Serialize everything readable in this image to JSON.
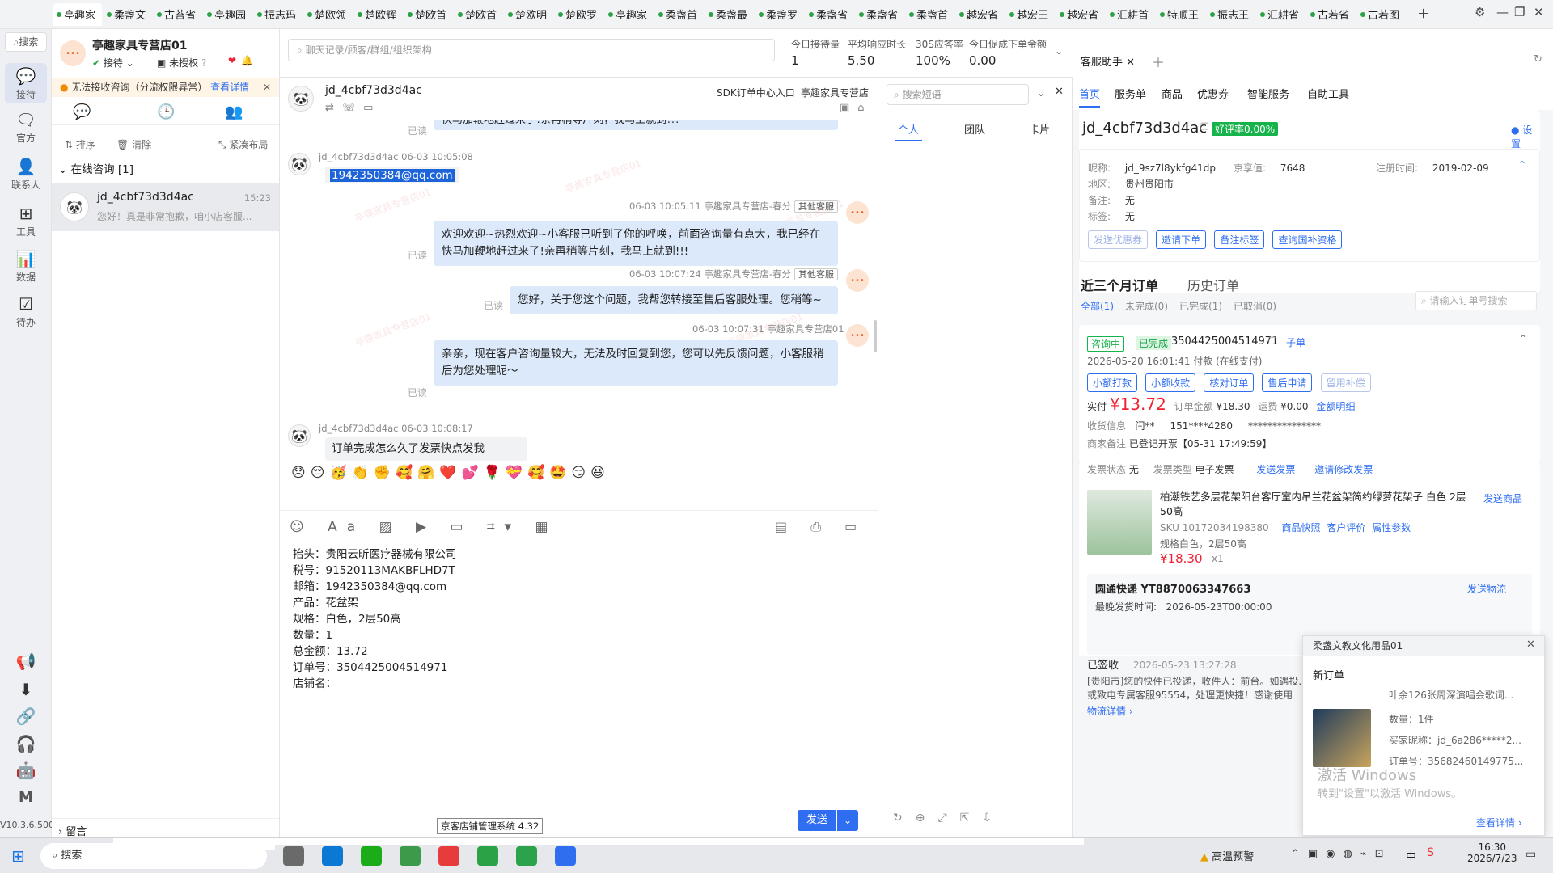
{
  "tabs": [
    "亭趣家",
    "柔盏文",
    "古苔省",
    "亭趣园",
    "振志玛",
    "楚欧领",
    "楚欧辉",
    "楚欧首",
    "楚欧首",
    "楚欧明",
    "楚欧罗",
    "亭趣家",
    "柔盏首",
    "柔盏最",
    "柔盏罗",
    "柔盏省",
    "柔盏省",
    "柔盏首",
    "越宏省",
    "越宏王",
    "越宏省",
    "汇耕首",
    "特顺王",
    "振志王",
    "汇耕省",
    "古若省",
    "古若图"
  ],
  "nav": {
    "search": "搜索",
    "items": [
      "接待",
      "官方",
      "联系人",
      "工具",
      "数据",
      "待办"
    ],
    "version": "V10.3.6.500"
  },
  "convlist": {
    "shop_name": "亭趣家具专营店01",
    "status": "接待",
    "auth": "未授权",
    "warning": "无法接收咨询（分流权限异常）",
    "warning_link": "查看详情",
    "actions": [
      "排序",
      "清除",
      "紧凑布局"
    ],
    "group": "在线咨询 [1]",
    "conv_name": "jd_4cbf73d3d4ac",
    "conv_time": "15:23",
    "conv_preview": "您好！真是非常抱歉，咱小店客服...",
    "footer": "留言"
  },
  "stats": {
    "search_placeholder": "聊天记录/顾客/群组/组织架构",
    "items": [
      {
        "label": "今日接待量",
        "value": "1"
      },
      {
        "label": "平均响应时长",
        "value": "5.50"
      },
      {
        "label": "30S应答率",
        "value": "100%"
      },
      {
        "label": "今日促成下单金额",
        "value": "0.00"
      }
    ]
  },
  "chat": {
    "title": "jd_4cbf73d3d4ac",
    "sdk": "SDK订单中心入口",
    "shop": "亭趣家具专营店",
    "top_bubble_tail": "快马加鞭地赶过来了!亲再稍等片刻，我马上就到!!!",
    "read": "已读",
    "messages": [
      {
        "meta": "jd_4cbf73d3d4ac  06-03 10:05:08",
        "text": "1942350384@qq.com"
      },
      {
        "meta": "06-03 10:05:11  亭趣家具专营店-春分",
        "tag": "其他客服",
        "text": "欢迎欢迎~热烈欢迎~小客服已听到了你的呼唤，前面咨询量有点大，我已经在快马加鞭地赶过来了!亲再稍等片刻，我马上就到!!!"
      },
      {
        "meta": "06-03 10:07:24  亭趣家具专营店-春分",
        "tag": "其他客服",
        "text": "您好，关于您这个问题，我帮您转接至售后客服处理。您稍等~"
      },
      {
        "meta": "06-03 10:07:31  亭趣家具专营店01",
        "text": "亲亲，现在客户咨询量较大，无法及时回复到您，您可以先反馈问题，小客服稍后为您处理呢～"
      },
      {
        "meta": "jd_4cbf73d3d4ac  06-03 10:08:17",
        "text": "订单完成怎么久了发票快点发我"
      }
    ],
    "emojis": [
      "😞",
      "😔",
      "🥳",
      "👏",
      "✊",
      "🥰",
      "🤗",
      "❤️",
      "💕",
      "🌹",
      "💝",
      "🥰",
      "🤩",
      "😏",
      "😆"
    ],
    "input_lines": [
      "抬头：贵阳云昕医疗器械有限公司",
      "税号：91520113MAKBFLHD7T",
      "邮箱：1942350384@qq.com",
      "产品：花盆架",
      "规格：白色，2层50高",
      "数量：1",
      "总金额：13.72",
      "订单号：3504425004514971",
      "店铺名："
    ],
    "send": "发送",
    "tooltip": "京客店铺管理系统 4.32",
    "watermark": "亭趣家具专营店01"
  },
  "phrases": {
    "search_placeholder": "搜索短语",
    "tabs": [
      "个人",
      "团队",
      "卡片"
    ]
  },
  "right": {
    "tab_title": "客服助手",
    "nav": [
      "首页",
      "服务单",
      "商品",
      "优惠券",
      "智能服务",
      "自助工具"
    ],
    "customer": "jd_4cbf73d3d4ac",
    "badge": "好评率0.00%",
    "settings": "设置",
    "nick_label": "昵称:",
    "nick": "jd_9sz7l8ykfg41dp",
    "jx_label": "京享值:",
    "jx": "7648",
    "reg_label": "注册时间:",
    "reg": "2019-02-09",
    "area_label": "地区:",
    "area": "贵州贵阳市",
    "note_label": "备注:",
    "note": "无",
    "tag_label": "标签:",
    "tag": "无",
    "buttons": [
      "发送优惠券",
      "邀请下单",
      "备注标签",
      "查询国补资格"
    ],
    "orders_tab1": "近三个月订单",
    "orders_tab2": "历史订单",
    "filters": [
      "全部(1)",
      "未完成(0)",
      "已完成(1)",
      "已取消(0)"
    ],
    "order_search": "请输入订单号搜索",
    "order": {
      "status1": "咨询中",
      "status2": "已完成",
      "id": "3504425004514971",
      "sub": "子单",
      "time": "2026-05-20 16:01:41  付款  (在线支付)",
      "btns": [
        "小额打款",
        "小额收款",
        "核对订单",
        "售后申请",
        "留用补偿"
      ],
      "paid_label": "实付",
      "paid": "¥13.72",
      "amount_label": "订单金额",
      "amount": "¥18.30",
      "ship_label": "运费",
      "ship": "¥0.00",
      "detail": "金额明细",
      "recv_label": "收货信息",
      "recv": "闫**     151****4280     ***************",
      "merchant_label": "商家备注",
      "merchant": "已登记开票【05-31 17:49:59】",
      "invoice_label": "发票状态",
      "invoice": "无",
      "invtype_label": "发票类型",
      "invtype": "电子发票",
      "inv_links": [
        "发送发票",
        "邀请修改发票"
      ],
      "product_title": "柏潮铁艺多层花架阳台客厅室内吊兰花盆架简约绿萝花架子 白色 2层50高",
      "send_product": "发送商品",
      "sku": "SKU 10172034198380",
      "sku_links": [
        "商品快照",
        "客户评价",
        "属性参数"
      ],
      "spec": "规格白色，2层50高",
      "price": "¥18.30",
      "qty": "x1",
      "logistics": "圆通快递 YT8870063347663",
      "send_logistics": "发送物流",
      "ship_time": "最晚发货时间:   2026-05-23T00:00:00",
      "signed": "已签收",
      "signed_time": "2026-05-23 13:27:28",
      "track": "[贵阳市]您的快件已投递，收件人：前台。如遇投... 或致电专属客服95554，处理更快捷！感谢使用",
      "track_link": "物流详情"
    }
  },
  "notif": {
    "title": "柔盏文教文化用品01",
    "sub": "新订单",
    "line1": "叶余126张周深演唱会歌词...",
    "qty": "数量：1件",
    "buyer": "买家昵称：jd_6a286*****2...",
    "orderno": "订单号：35682460149775...",
    "activate1": "激活 Windows",
    "activate2": "转到\"设置\"以激活 Windows。",
    "more": "查看详情"
  },
  "taskbar": {
    "search": "搜索",
    "weather": "高温预警",
    "time": "16:30",
    "date": "2026/7/23",
    "ime": "中"
  }
}
